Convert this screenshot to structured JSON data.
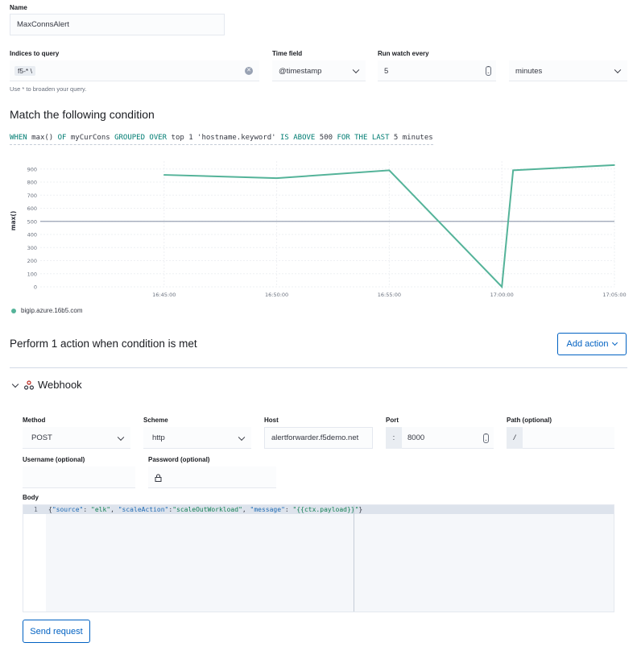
{
  "name": {
    "label": "Name",
    "value": "MaxConnsAlert"
  },
  "indices": {
    "label": "Indices to query",
    "value": "f5-* \\",
    "hint": "Use * to broaden your query."
  },
  "time_field": {
    "label": "Time field",
    "value": "@timestamp"
  },
  "run_every": {
    "label": "Run watch every",
    "value": "5",
    "unit": "minutes"
  },
  "condition": {
    "heading": "Match the following condition",
    "tokens": [
      {
        "t": "WHEN",
        "kw": true
      },
      {
        "t": " max()",
        "kw": false
      },
      {
        "t": " OF",
        "kw": true
      },
      {
        "t": " myCurCons",
        "kw": false
      },
      {
        "t": " GROUPED OVER",
        "kw": true
      },
      {
        "t": " top 1 'hostname.keyword'",
        "kw": false
      },
      {
        "t": " IS ABOVE",
        "kw": true
      },
      {
        "t": " 500",
        "kw": false
      },
      {
        "t": " FOR THE LAST",
        "kw": true
      },
      {
        "t": " 5 minutes",
        "kw": false
      }
    ]
  },
  "chart_data": {
    "type": "line",
    "ylabel": "max()",
    "xlabel": "",
    "y_ticks": [
      0,
      100,
      200,
      300,
      400,
      500,
      600,
      700,
      800,
      900
    ],
    "ylim": [
      0,
      960
    ],
    "x_ticks": [
      "16:45:00",
      "16:50:00",
      "16:55:00",
      "17:00:00",
      "17:05:00"
    ],
    "x_tick_minutes": [
      0,
      5,
      10,
      15,
      20
    ],
    "xlim_minutes": [
      -5.5,
      20
    ],
    "threshold": 500,
    "grid": true,
    "legend_position": "bottom-left",
    "series": [
      {
        "name": "bigip.azure.16b5.com",
        "color": "#54b399",
        "x_minutes": [
          0,
          5,
          10,
          15,
          15.5,
          20
        ],
        "values": [
          855,
          830,
          890,
          0,
          890,
          930
        ]
      }
    ]
  },
  "actions": {
    "heading": "Perform 1 action when condition is met",
    "add_button": "Add action"
  },
  "webhook": {
    "title": "Webhook",
    "method": {
      "label": "Method",
      "value": "POST"
    },
    "scheme": {
      "label": "Scheme",
      "value": "http"
    },
    "host": {
      "label": "Host",
      "value": "alertforwarder.f5demo.net"
    },
    "port": {
      "label": "Port",
      "prefix": ":",
      "value": "8000"
    },
    "path": {
      "label": "Path (optional)",
      "prefix": "/",
      "value": ""
    },
    "username": {
      "label": "Username (optional)",
      "value": ""
    },
    "password": {
      "label": "Password (optional)",
      "value": ""
    },
    "body": {
      "label": "Body",
      "line_number": "1",
      "code_tokens": [
        {
          "t": "{",
          "c": "#343741"
        },
        {
          "t": "\"source\"",
          "c": "#1f6bb5"
        },
        {
          "t": ": ",
          "c": "#343741"
        },
        {
          "t": "\"elk\"",
          "c": "#138054"
        },
        {
          "t": ", ",
          "c": "#343741"
        },
        {
          "t": "\"scaleAction\"",
          "c": "#1f6bb5"
        },
        {
          "t": ":",
          "c": "#343741"
        },
        {
          "t": "\"scaleOutWorkload\"",
          "c": "#138054"
        },
        {
          "t": ", ",
          "c": "#343741"
        },
        {
          "t": "\"message\"",
          "c": "#1f6bb5"
        },
        {
          "t": ": ",
          "c": "#343741"
        },
        {
          "t": "\"{{ctx.payload}}\"",
          "c": "#138054"
        },
        {
          "t": "}",
          "c": "#343741"
        }
      ]
    },
    "send_button": "Send request"
  }
}
